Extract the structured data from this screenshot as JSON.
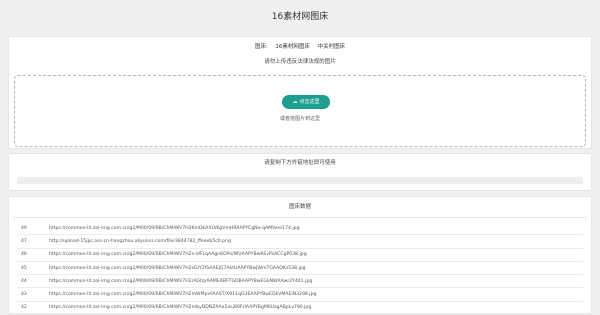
{
  "page_title": "16素材网图床",
  "sources": {
    "label": "图床:",
    "option1": "16素材网图床",
    "option2": "中关村图床"
  },
  "upload": {
    "hint": "请勿上传违反法律法规的图片",
    "button_label": "点击这里",
    "drag_hint": "或者拖图片到这里"
  },
  "link": {
    "hint": "请复制下方外链地址即可使用"
  },
  "records": {
    "title": "图床数据",
    "rows": [
      {
        "id": "49",
        "url": "https://common-lit.zol-img.com.cn/g2/M00/09/0B/ChMlWV7H36mDkAXU/KgVmHRAAPYCgNe-qAMVem174.jpg"
      },
      {
        "id": "47",
        "url": "http://upload-15jpc.oss-cn-hangzhou.aliyuncs.com/file/3844782_ffeeeb5c0.png"
      },
      {
        "id": "46",
        "url": "https://common-lit.zol-img.com.cn/g2/M00/09/0B/ChMlWV7H2s-ldFLqAAgn6OPo/WUAAPYBwKEvPsACCgP038.jpg"
      },
      {
        "id": "45",
        "url": "https://common-lit.zol-img.com.cn/g2/M00/09/0B/ChMlWV7H2sGIY2fSAAEJG7AktUAAPYBwJWmTGAAQKs538.jpg"
      },
      {
        "id": "44",
        "url": "https://common-lit.zol-img.com.cn/g2/M00/09/0B/ChMlWV7H2rAGlzyAAMEABFTGDBAAPYBwEGkNWAAwr2Y441.jpg"
      },
      {
        "id": "43",
        "url": "https://common-lit.zol-img.com.cn/g2/M00/09/0B/ChMlWV7H2mWMpvFAAST/X911qO3EAAPYBwEDkVMAEiN3298.jpg"
      },
      {
        "id": "42",
        "url": "https://common-lit.zol-img.com.cn/g2/M00/09/0B/ChMlWV7H2mbyDDNZAAa5xLj80FUAAPYBgM6UzgABpLv790.jpg"
      }
    ]
  }
}
